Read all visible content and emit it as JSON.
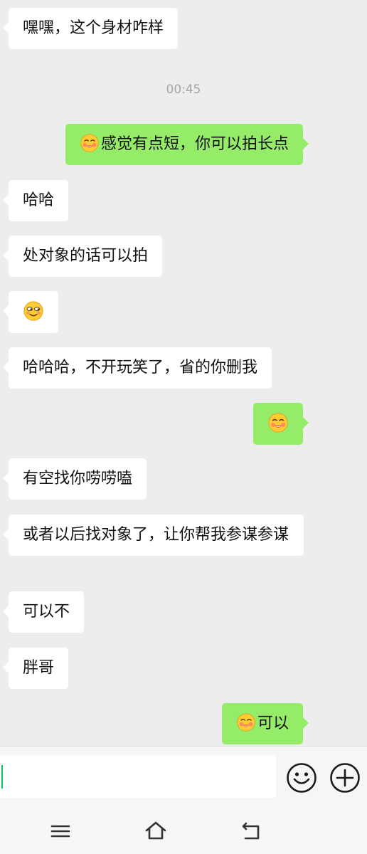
{
  "chat": {
    "timestamp": "00:45",
    "messages": [
      {
        "side": "received",
        "text": "嘿嘿，这个身材咋样"
      },
      {
        "side": "sent",
        "emoji": "smiling-face-with-red-cheeks-emoji",
        "text": "感觉有点短，你可以拍长点"
      },
      {
        "side": "received",
        "text": "哈哈"
      },
      {
        "side": "received",
        "text": "处对象的话可以拍"
      },
      {
        "side": "received",
        "emoji": "smug-face-emoji",
        "text": ""
      },
      {
        "side": "received",
        "text": "哈哈哈，不开玩笑了，省的你删我"
      },
      {
        "side": "sent",
        "emoji": "smiling-face-with-red-cheeks-emoji",
        "text": ""
      },
      {
        "side": "received",
        "text": "有空找你唠唠嗑"
      },
      {
        "side": "received",
        "text": "或者以后找对象了，让你帮我参谋参谋"
      },
      {
        "side": "received",
        "text": "可以不"
      },
      {
        "side": "received",
        "text": "胖哥"
      },
      {
        "side": "sent",
        "emoji": "smiling-face-with-red-cheeks-emoji",
        "text": "可以"
      }
    ]
  },
  "input_bar": {
    "value": "",
    "icons": [
      "emoji-icon",
      "plus-icon"
    ]
  },
  "nav_bar": {
    "icons": [
      "menu-icon",
      "home-icon",
      "back-icon"
    ]
  },
  "colors": {
    "background": "#ededed",
    "sent_bubble": "#95ec69",
    "received_bubble": "#ffffff",
    "caret": "#07c160"
  }
}
